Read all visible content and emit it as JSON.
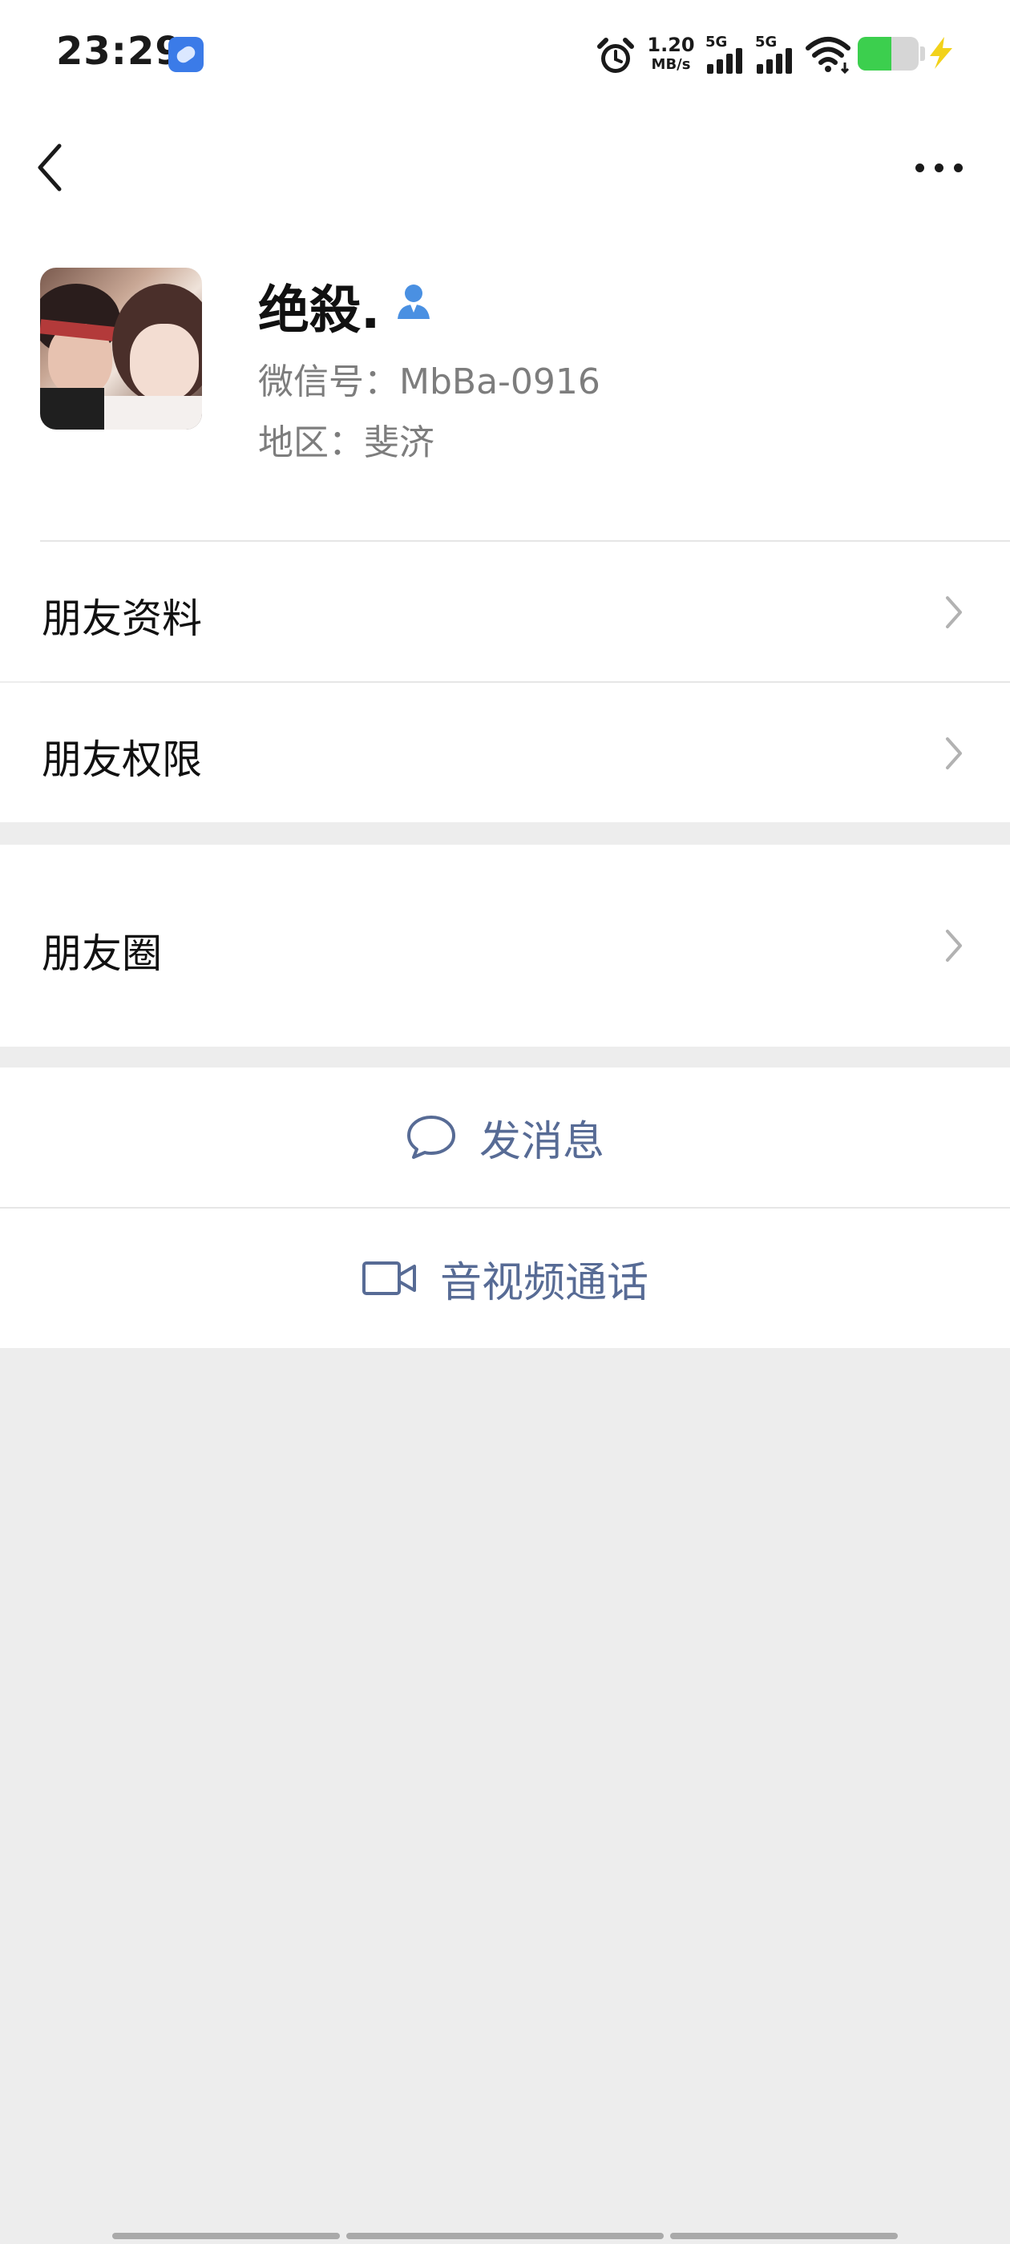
{
  "status_bar": {
    "time": "23:29",
    "app_icon": "browser-app-icon",
    "net_speed_value": "1.20",
    "net_speed_unit": "MB/s",
    "sim1_type": "5G",
    "sim2_type": "5G",
    "battery_level": 0.55,
    "icons": [
      "alarm-icon",
      "signal-icon",
      "signal-icon",
      "wifi-icon",
      "battery-icon",
      "charging-icon"
    ]
  },
  "nav": {
    "back_icon": "chevron-left-icon",
    "more_icon": "more-dots-icon"
  },
  "profile": {
    "name": "绝殺.",
    "wechat_id": "微信号：MbBa-0916",
    "region": "地区：斐济",
    "contact_icon": "contact-person-icon",
    "accent_color": "#4a90e2"
  },
  "menu": {
    "items": [
      {
        "label": "朋友资料"
      },
      {
        "label": "朋友权限"
      },
      {
        "label": "朋友圈"
      }
    ]
  },
  "actions": {
    "message_label": "发消息",
    "call_label": "音视频通话",
    "link_color": "#576b95"
  },
  "colors": {
    "background": "#ededed",
    "surface": "#ffffff",
    "secondary_text": "#7d7d7d"
  }
}
